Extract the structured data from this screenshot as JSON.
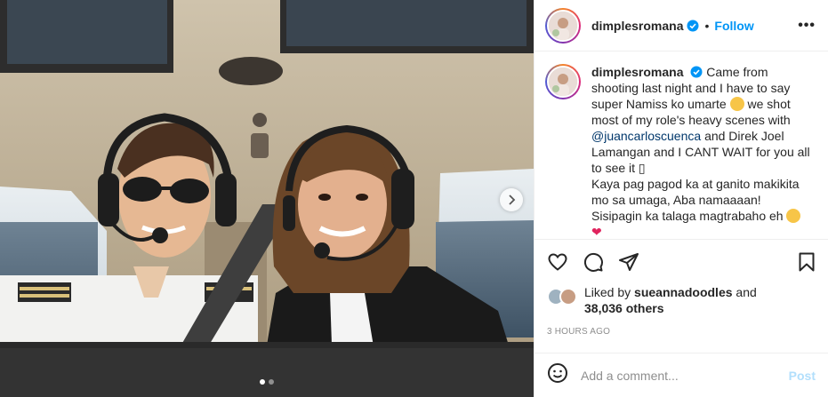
{
  "post": {
    "username": "dimplesromana",
    "follow_label": "Follow",
    "bullet": "•",
    "more_label": "•••",
    "caption": {
      "line1": "Came from shooting last night and I have to say super Namiss ko umarte",
      "line2": "we shot most of my role's heavy scenes with",
      "mention": "@juancarloscuenca",
      "line3": "and Direk Joel Lamangan and I CANT WAIT for you all to see it",
      "box_char": "▯",
      "line4": "Kaya pag pagod ka at ganito makikita mo sa umaga, Aba namaaaan!",
      "line5": "Sisipagin ka talaga magtrabaho eh",
      "heart": "❤"
    },
    "likes": {
      "prefix": "Liked by",
      "liker": "sueannadoodles",
      "and": "and",
      "others": "38,036 others"
    },
    "time_ago": "3 HOURS AGO",
    "comment": {
      "placeholder": "Add a comment...",
      "post_label": "Post"
    },
    "carousel": {
      "total": 2,
      "current": 1
    }
  },
  "icons": {
    "verified": "verified-badge-icon",
    "like": "heart-outline-icon",
    "comment": "comment-bubble-icon",
    "share": "paper-plane-icon",
    "save": "bookmark-icon",
    "emoji": "smiley-icon",
    "next": "chevron-right-icon"
  },
  "colors": {
    "accent": "#0095f6",
    "post_disabled": "#b2dffc",
    "mention": "#00376b",
    "muted": "#8e8e8e"
  }
}
